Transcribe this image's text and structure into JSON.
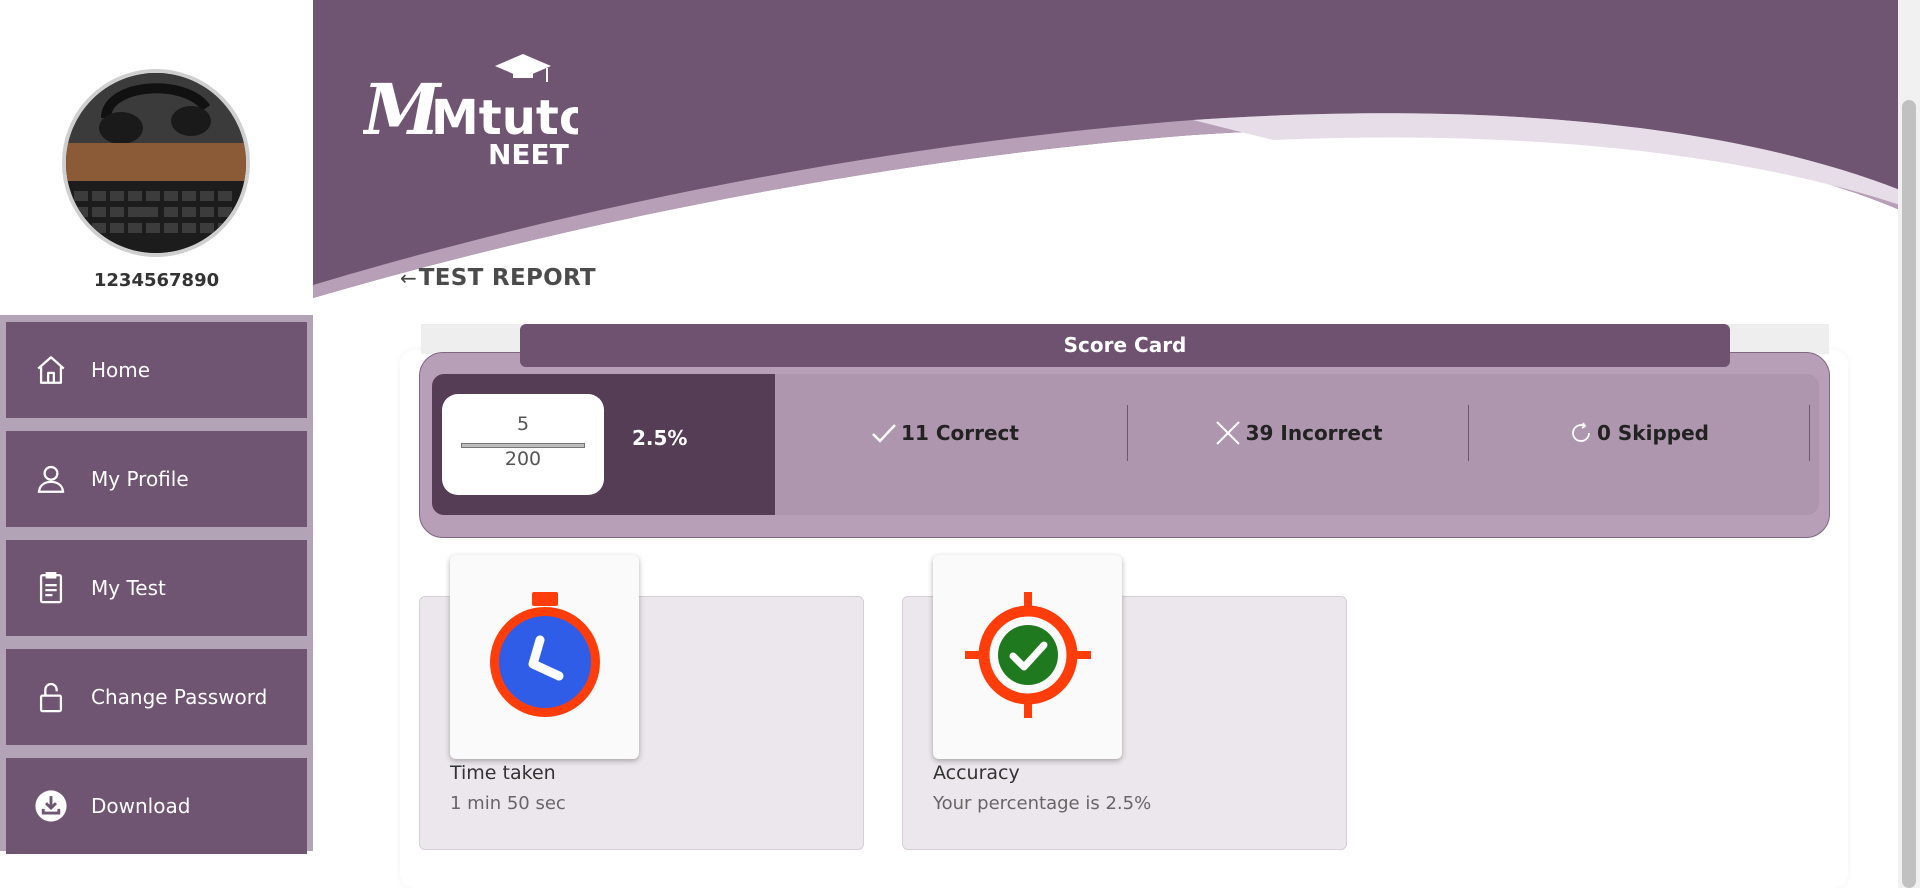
{
  "sidebar": {
    "username": "1234567890",
    "items": [
      {
        "label": "Home",
        "icon": "home-icon"
      },
      {
        "label": "My Profile",
        "icon": "user-icon"
      },
      {
        "label": "My Test",
        "icon": "clipboard-icon"
      },
      {
        "label": "Change Password",
        "icon": "lock-icon"
      },
      {
        "label": "Download",
        "icon": "download-icon"
      }
    ]
  },
  "header": {
    "logo_text": "Mtutor",
    "logo_sub": "NEET"
  },
  "page": {
    "back_arrow": "←",
    "title": "TEST REPORT"
  },
  "scorecard": {
    "tab_label": "Score Card",
    "score": "5",
    "total": "200",
    "percentage": "2.5%",
    "correct": "11 Correct",
    "incorrect": "39 Incorrect",
    "skipped": "0 Skipped"
  },
  "cards": {
    "time": {
      "title": "Time taken",
      "value": "1 min 50 sec",
      "icon": "stopwatch-icon"
    },
    "accuracy": {
      "title": "Accuracy",
      "value": "Your percentage is 2.5%",
      "icon": "target-icon"
    }
  },
  "colors": {
    "brand": "#6f5572",
    "brand_dark": "#553e55",
    "brand_light": "#b69fb7",
    "menu_bg": "#b3a3b7"
  }
}
